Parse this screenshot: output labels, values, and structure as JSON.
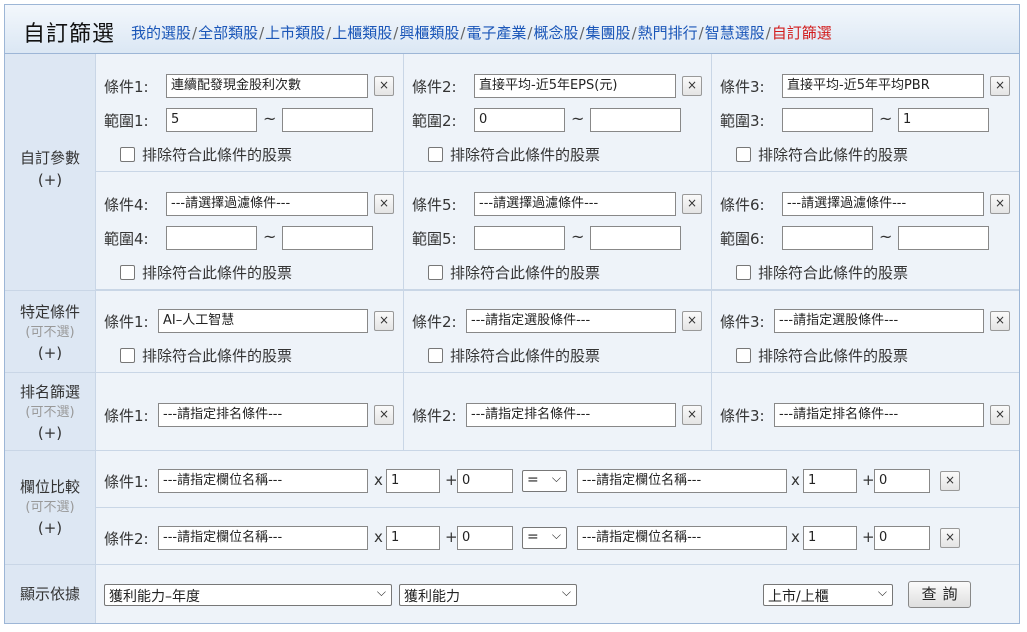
{
  "header": {
    "title": "自訂篩選",
    "nav": [
      "我的選股",
      "全部類股",
      "上市類股",
      "上櫃類股",
      "興櫃類股",
      "電子產業",
      "概念股",
      "集團股",
      "熱門排行",
      "智慧選股",
      "自訂篩選"
    ],
    "active": "自訂篩選",
    "sep": "/"
  },
  "sections": {
    "custom": {
      "label": "自訂參數",
      "plus": "(+)"
    },
    "specific": {
      "label": "特定條件",
      "optional": "(可不選)",
      "plus": "(+)"
    },
    "ranking": {
      "label": "排名篩選",
      "optional": "(可不選)",
      "plus": "(+)"
    },
    "compare": {
      "label": "欄位比較",
      "optional": "(可不選)",
      "plus": "(+)"
    },
    "display": {
      "label": "顯示依據"
    }
  },
  "custom_conditions": [
    {
      "label": "條件1:",
      "value": "連續配發現金股利次數",
      "range_label": "範圍1:",
      "min": "5",
      "max": ""
    },
    {
      "label": "條件2:",
      "value": "直接平均-近5年EPS(元)",
      "range_label": "範圍2:",
      "min": "0",
      "max": ""
    },
    {
      "label": "條件3:",
      "value": "直接平均-近5年平均PBR",
      "range_label": "範圍3:",
      "min": "",
      "max": "1"
    },
    {
      "label": "條件4:",
      "value": "---請選擇過濾條件---",
      "range_label": "範圍4:",
      "min": "",
      "max": ""
    },
    {
      "label": "條件5:",
      "value": "---請選擇過濾條件---",
      "range_label": "範圍5:",
      "min": "",
      "max": ""
    },
    {
      "label": "條件6:",
      "value": "---請選擇過濾條件---",
      "range_label": "範圍6:",
      "min": "",
      "max": ""
    }
  ],
  "exclude_label": "排除符合此條件的股票",
  "tilde": "~",
  "clear": "×",
  "specific_conditions": [
    {
      "label": "條件1:",
      "value": "AI–人工智慧"
    },
    {
      "label": "條件2:",
      "value": "---請指定選股條件---"
    },
    {
      "label": "條件3:",
      "value": "---請指定選股條件---"
    }
  ],
  "ranking_conditions": [
    {
      "label": "條件1:",
      "value": "---請指定排名條件---"
    },
    {
      "label": "條件2:",
      "value": "---請指定排名條件---"
    },
    {
      "label": "條件3:",
      "value": "---請指定排名條件---"
    }
  ],
  "compare_conditions": [
    {
      "label": "條件1:",
      "left": "---請指定欄位名稱---",
      "left_mul": "1",
      "left_add": "0",
      "op": "=",
      "right": "---請指定欄位名稱---",
      "right_mul": "1",
      "right_add": "0"
    },
    {
      "label": "條件2:",
      "left": "---請指定欄位名稱---",
      "left_mul": "1",
      "left_add": "0",
      "op": "=",
      "right": "---請指定欄位名稱---",
      "right_mul": "1",
      "right_add": "0"
    }
  ],
  "compare_ops": {
    "x": "x",
    "plus": "+"
  },
  "display": {
    "select1": "獲利能力–年度",
    "select2": "獲利能力",
    "market": "上市/上櫃",
    "query": "查詢"
  }
}
